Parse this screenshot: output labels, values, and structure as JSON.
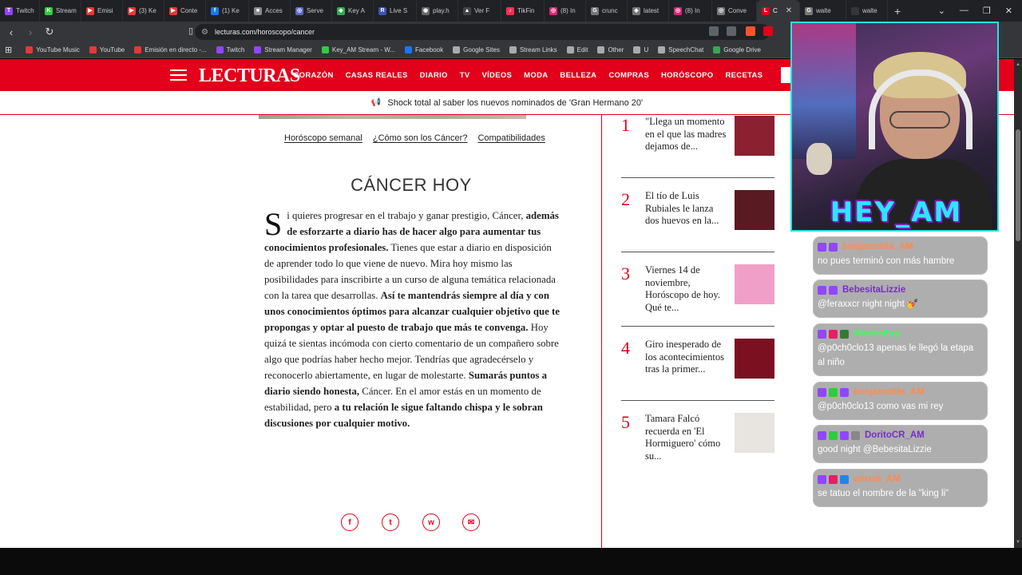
{
  "browser": {
    "tabs": [
      {
        "label": "Twitch",
        "color": "#9146ff",
        "glyph": "T"
      },
      {
        "label": "Stream",
        "color": "#2ecc40",
        "glyph": "K"
      },
      {
        "label": "Emisi",
        "color": "#e53935",
        "glyph": "▶"
      },
      {
        "label": "(3) Ke",
        "color": "#e53935",
        "glyph": "▶"
      },
      {
        "label": "Conte",
        "color": "#e53935",
        "glyph": "▶"
      },
      {
        "label": "(1) Ke",
        "color": "#1877f2",
        "glyph": "f"
      },
      {
        "label": "Acces",
        "color": "#888888",
        "glyph": "■"
      },
      {
        "label": "Serve",
        "color": "#5c6bc0",
        "glyph": "◎"
      },
      {
        "label": "Key A",
        "color": "#34a853",
        "glyph": "◆"
      },
      {
        "label": "Live S",
        "color": "#3f51b5",
        "glyph": "R"
      },
      {
        "label": "play.h",
        "color": "#666666",
        "glyph": "◉"
      },
      {
        "label": "Ver F",
        "color": "#444444",
        "glyph": "▲"
      },
      {
        "label": "TikFin",
        "color": "#ff2d55",
        "glyph": "♪"
      },
      {
        "label": "(8) In",
        "color": "#d62976",
        "glyph": "◎"
      },
      {
        "label": "crunc",
        "color": "#777777",
        "glyph": "G"
      },
      {
        "label": "latest",
        "color": "#777777",
        "glyph": "◈"
      },
      {
        "label": "(8) In",
        "color": "#d62976",
        "glyph": "◎"
      },
      {
        "label": "Conve",
        "color": "#777777",
        "glyph": "◎"
      },
      {
        "label": "C",
        "color": "#e2001a",
        "glyph": "L",
        "active": true
      },
      {
        "label": "walte",
        "color": "#777777",
        "glyph": "G"
      },
      {
        "label": "walte",
        "color": "#35363a",
        "glyph": ""
      }
    ],
    "url": "lecturas.com/horoscopo/cancer",
    "bookmarks": [
      {
        "label": "YouTube Music",
        "color": "#e53935"
      },
      {
        "label": "YouTube",
        "color": "#e53935"
      },
      {
        "label": "Emisión en directo -...",
        "color": "#e53935"
      },
      {
        "label": "Twitch",
        "color": "#9146ff"
      },
      {
        "label": "Stream Manager",
        "color": "#9146ff"
      },
      {
        "label": "Key_AM Stream - W...",
        "color": "#2ecc40"
      },
      {
        "label": "Facebook",
        "color": "#1877f2"
      },
      {
        "label": "Google Sites",
        "color": "#aaaaaa"
      },
      {
        "label": "Stream Links",
        "color": "#aaaaaa"
      },
      {
        "label": "Edit",
        "color": "#aaaaaa"
      },
      {
        "label": "Other",
        "color": "#aaaaaa"
      },
      {
        "label": "U",
        "color": "#aaaaaa"
      },
      {
        "label": "SpeechChat",
        "color": "#aaaaaa"
      },
      {
        "label": "Google Drive",
        "color": "#34a853"
      }
    ]
  },
  "site": {
    "logo": "LECTURAS",
    "nav": [
      "CORAZÓN",
      "CASAS REALES",
      "DIARIO",
      "TV",
      "VÍDEOS",
      "MODA",
      "BELLEZA",
      "COMPRAS",
      "HORÓSCOPO",
      "RECETAS"
    ],
    "breaking": "Shock total al saber los nuevos nominados de 'Gran Hermano 20'",
    "subnav": [
      "Horóscopo semanal",
      "¿Cómo son los Cáncer?",
      "Compatibilidades"
    ],
    "article_title": "CÁNCER HOY",
    "article_dropcap": "S",
    "article_parts": [
      {
        "t": "i quieres progresar en el trabajo y ganar prestigio, Cáncer, ",
        "b": false
      },
      {
        "t": "además de esforzarte a diario has de hacer algo para aumentar tus conocimientos profesionales.",
        "b": true
      },
      {
        "t": " Tienes que estar a diario en disposición de aprender todo lo que viene de nuevo. Mira hoy mismo las posibilidades para inscribirte a un curso de alguna temática relacionada con la tarea que desarrollas. ",
        "b": false
      },
      {
        "t": "Así te mantendrás siempre al día y con unos conocimientos óptimos para alcanzar cualquier objetivo que te propongas y optar al puesto de trabajo que más te convenga.",
        "b": true
      },
      {
        "t": " Hoy quizá te sientas incómoda con cierto comentario de un compañero sobre algo que podrías haber hecho mejor. Tendrías que agradecérselo y reconocerlo abiertamente, en lugar de molestarte. ",
        "b": false
      },
      {
        "t": "Sumarás puntos a diario siendo honesta,",
        "b": true
      },
      {
        "t": " Cáncer. En el amor estás en un momento de estabilidad, pero ",
        "b": false
      },
      {
        "t": "a tu relación le sigue faltando chispa y le sobran discusiones por cualquier motivo.",
        "b": true
      }
    ],
    "ranking": [
      {
        "num": "1",
        "text": "\"Llega un momento en el que las madres dejamos de...",
        "thumb": "#8a2030"
      },
      {
        "num": "2",
        "text": "El tío de Luis Rubiales le lanza dos huevos en la...",
        "thumb": "#5a1a22"
      },
      {
        "num": "3",
        "text": "Viernes 14 de noviembre, Horóscopo de hoy. Qué te...",
        "thumb": "#f0a0c8"
      },
      {
        "num": "4",
        "text": "Giro inesperado de los acontecimientos tras la primer...",
        "thumb": "#7a1020"
      },
      {
        "num": "5",
        "text": "Tamara Falcó recuerda en 'El Hormiguero' cómo su...",
        "thumb": "#e8e4e0"
      }
    ],
    "share": [
      "f",
      "t",
      "w",
      "✉"
    ]
  },
  "stream": {
    "overlay_title": "HEY_AM",
    "chat": [
      {
        "user": "benjamotita_AM",
        "color": "#ff8a50",
        "msg": "no pues terminó con más hambre",
        "badges": [
          "#9146ff",
          "#9146ff"
        ]
      },
      {
        "user": "BebesitaLizzie",
        "color": "#7a2cc8",
        "msg": "@feraxxcr night night 💅",
        "badges": [
          "#9146ff",
          "#9146ff"
        ]
      },
      {
        "user": "MantraExp",
        "color": "#3cff5a",
        "msg": "@p0ch0clo13 apenas le llegó la etapa al niño",
        "badges": [
          "#9146ff",
          "#e91e63",
          "#2e7d32"
        ]
      },
      {
        "user": "benjamotita_AM",
        "color": "#ff8a50",
        "msg": "@p0ch0clo13 como vas mi rey",
        "badges": [
          "#9146ff",
          "#2ecc40",
          "#9146ff"
        ]
      },
      {
        "user": "DoritoCR_AM",
        "color": "#7a2cc8",
        "msg": "good night @BebesitaLizzie",
        "badges": [
          "#9146ff",
          "#2ecc40",
          "#9146ff",
          "#888"
        ]
      },
      {
        "user": "unreal_AM",
        "color": "#ff8a50",
        "msg": "se tatuo el nombre de la \"king li\"",
        "badges": [
          "#9146ff",
          "#e91e63",
          "#1e88e5"
        ]
      }
    ]
  }
}
